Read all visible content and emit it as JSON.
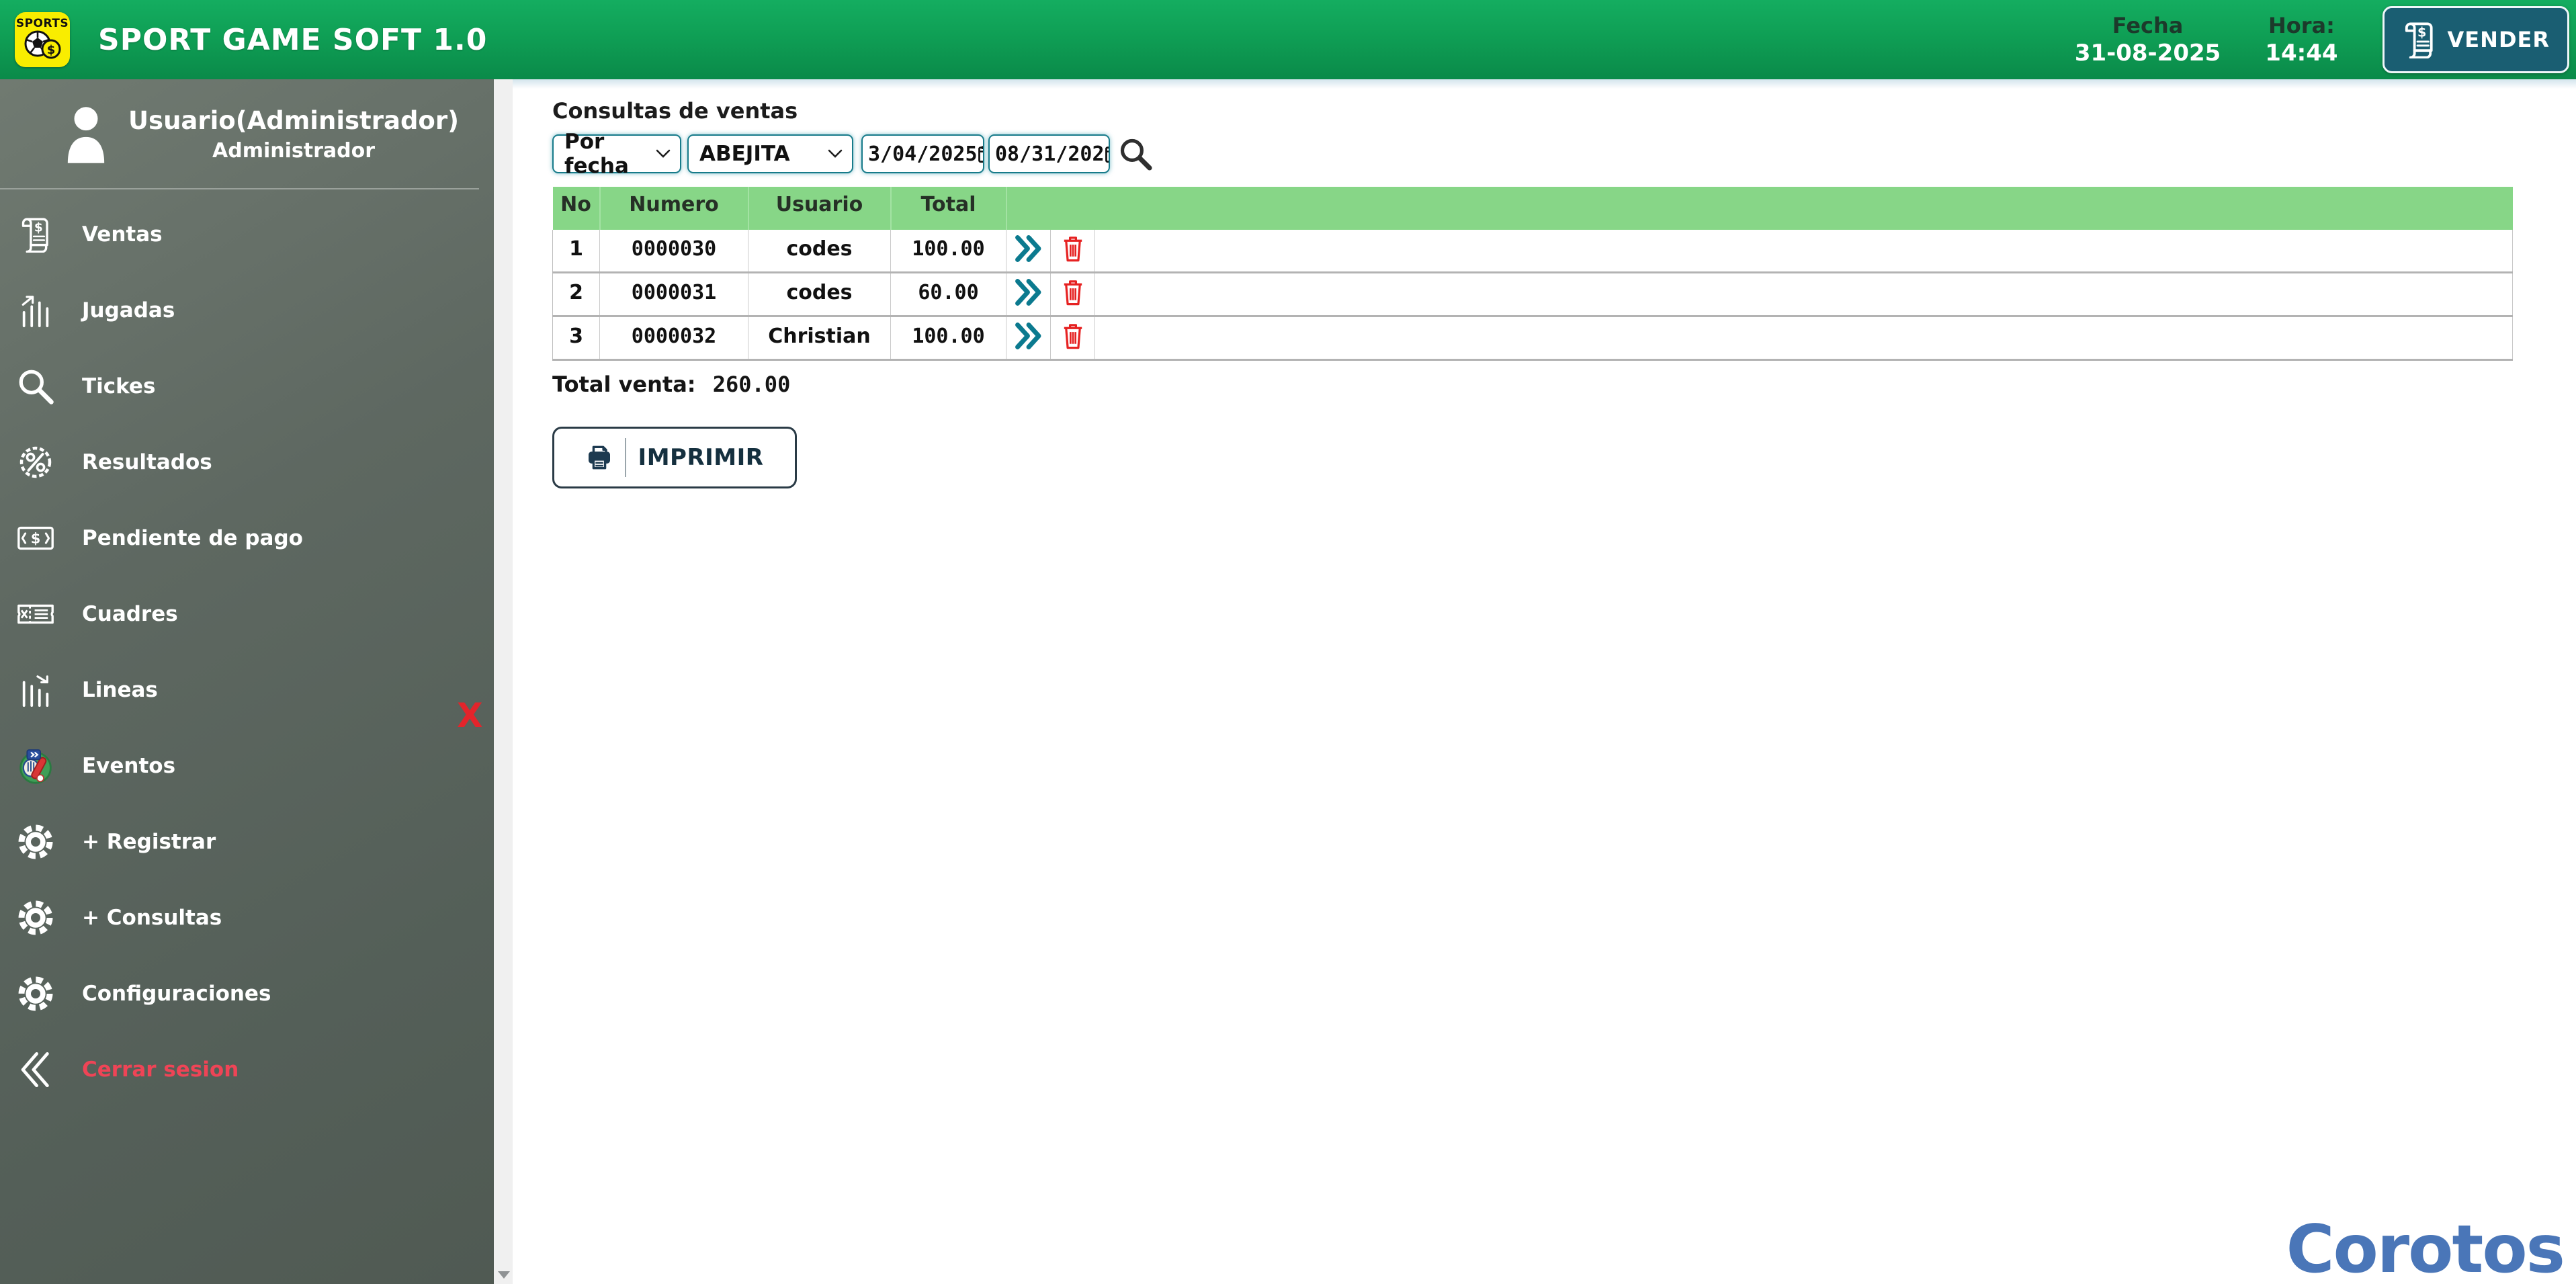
{
  "header": {
    "logo_text": "SPORTS",
    "app_title": "SPORT GAME SOFT 1.0",
    "fecha_label": "Fecha",
    "fecha_value": "31-08-2025",
    "hora_label": "Hora:",
    "hora_value": "14:44",
    "vender_label": "VENDER"
  },
  "sidebar": {
    "user_name": "Usuario(Administrador)",
    "user_role": "Administrador",
    "items": [
      {
        "label": "Ventas",
        "icon": "receipt-icon"
      },
      {
        "label": "Jugadas",
        "icon": "chart-up-icon"
      },
      {
        "label": "Tickes",
        "icon": "search-icon"
      },
      {
        "label": "Resultados",
        "icon": "percent-badge-icon"
      },
      {
        "label": "Pendiente de pago",
        "icon": "banknote-icon"
      },
      {
        "label": "Cuadres",
        "icon": "ticket-icon"
      },
      {
        "label": "Lineas",
        "icon": "chart-down-icon"
      },
      {
        "label": "Eventos",
        "icon": "sports-event-icon"
      },
      {
        "label": "+ Registrar",
        "icon": "gear-icon"
      },
      {
        "label": "+ Consultas",
        "icon": "gear-icon"
      },
      {
        "label": "Configuraciones",
        "icon": "gear-icon"
      }
    ],
    "logout_label": "Cerrar sesion",
    "close_x": "X"
  },
  "main": {
    "title": "Consultas de ventas",
    "filters": {
      "filter_type": "Por fecha",
      "filter_user": "ABEJITA",
      "date_from": "3/04/2025",
      "date_to": "08/31/202"
    },
    "table": {
      "columns": [
        "No",
        "Numero",
        "Usuario",
        "Total"
      ],
      "rows": [
        {
          "no": "1",
          "numero": "0000030",
          "usuario": "codes",
          "total": "100.00"
        },
        {
          "no": "2",
          "numero": "0000031",
          "usuario": "codes",
          "total": "60.00"
        },
        {
          "no": "3",
          "numero": "0000032",
          "usuario": "Christian",
          "total": "100.00"
        }
      ]
    },
    "total_label": "Total venta:",
    "total_value": "260.00",
    "print_label": "IMPRIMIR",
    "watermark": "Corotos"
  },
  "colors": {
    "header_green_top": "#14ad60",
    "header_green_bottom": "#0a8a49",
    "sidebar_gray": "#5b655e",
    "table_header_green": "#87d687",
    "accent_teal": "#0b7a8f",
    "danger_red": "#e23434",
    "logout_red": "#ef4456",
    "vender_teal": "#1a5e72",
    "watermark_blue": "#4a76b8",
    "logo_yellow": "#f9ed00"
  }
}
